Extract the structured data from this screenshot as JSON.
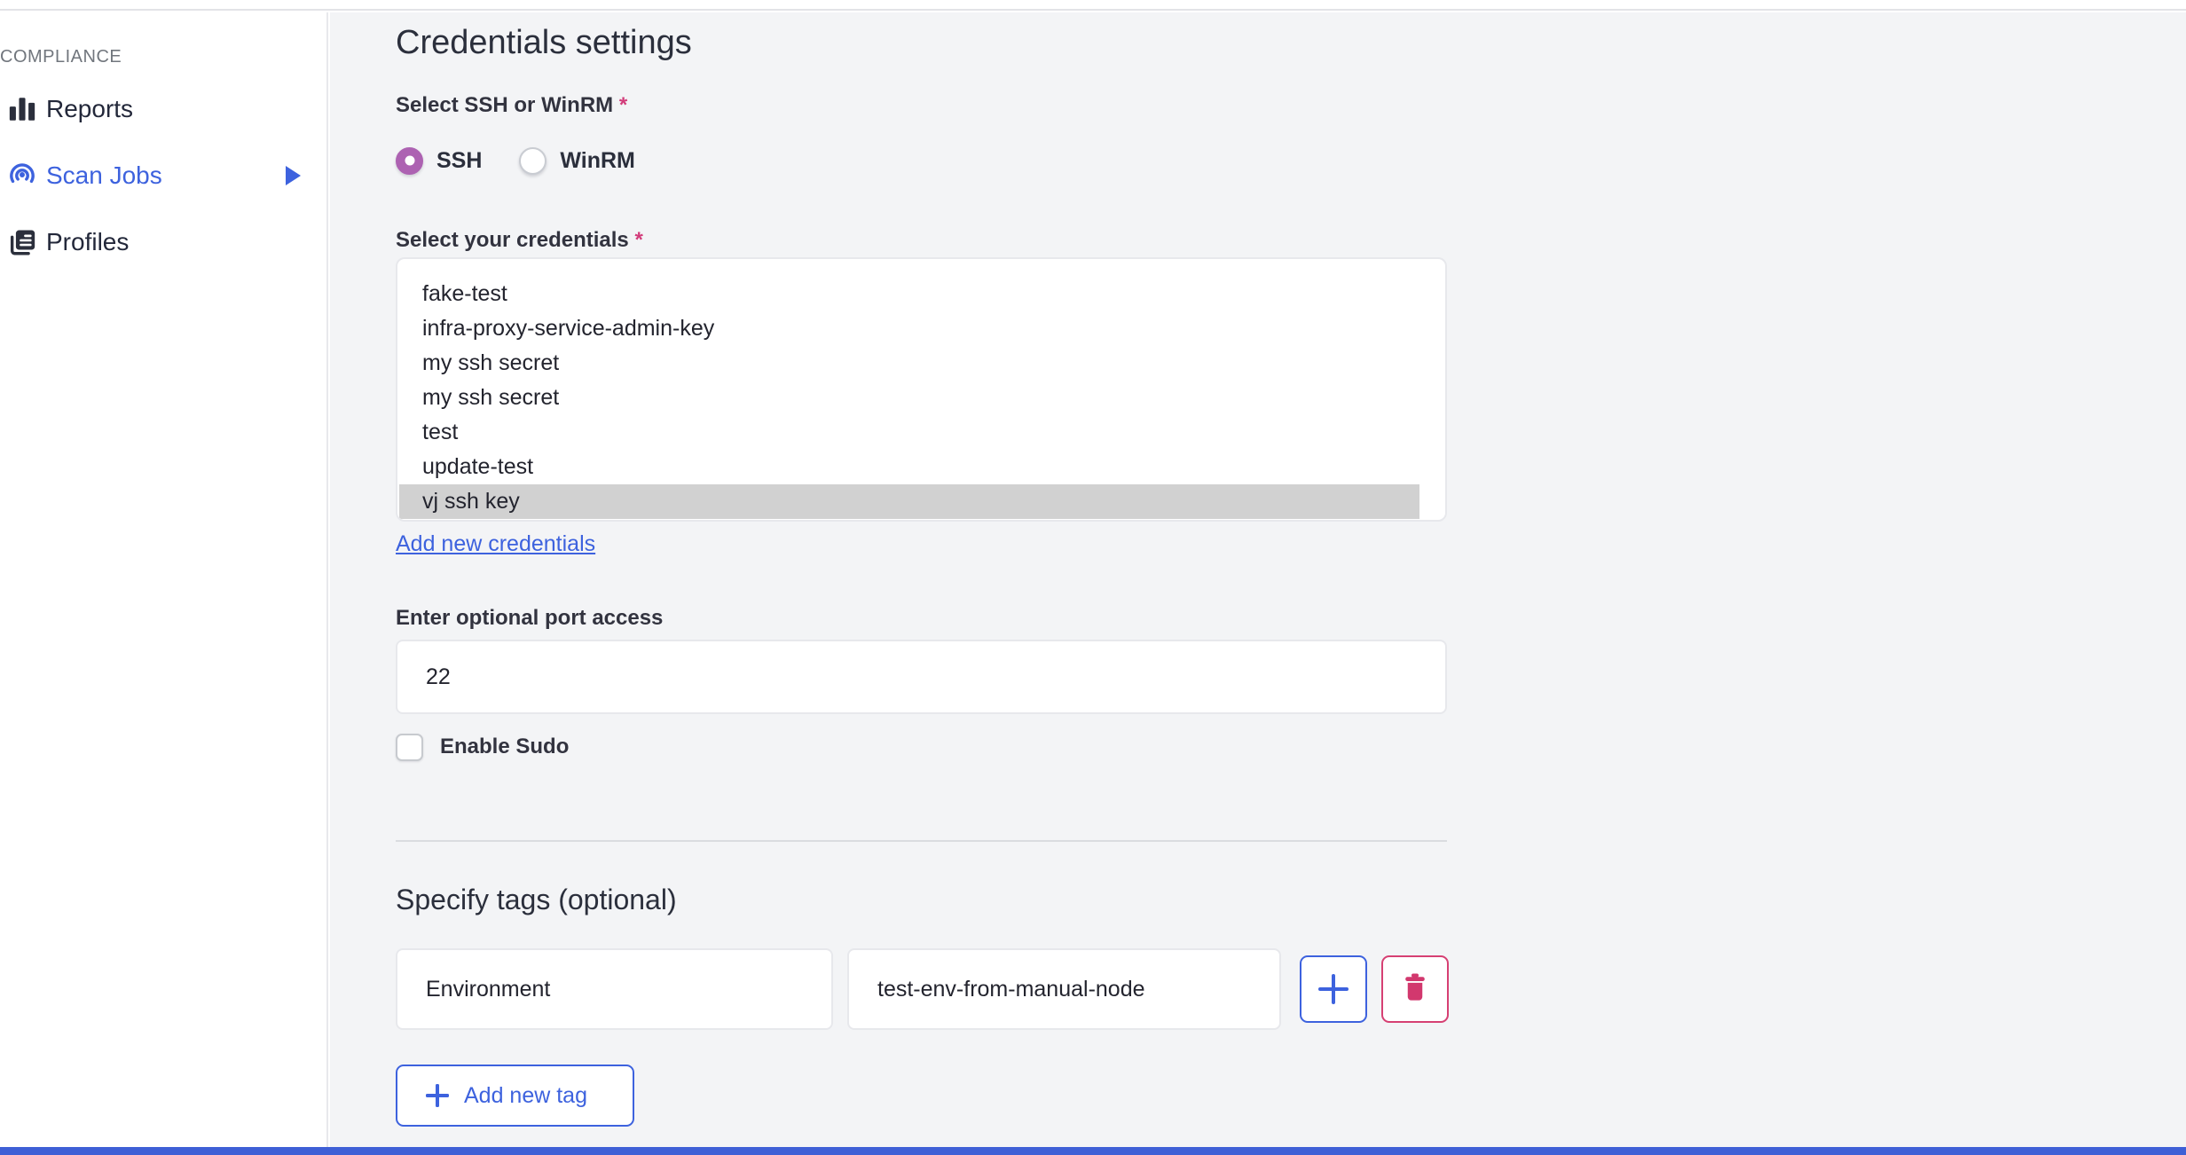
{
  "header": {
    "title": "Credentials settings"
  },
  "sidebar": {
    "section_label": "COMPLIANCE",
    "items": [
      {
        "label": "Reports",
        "icon": "bar-chart-icon",
        "active": false
      },
      {
        "label": "Scan Jobs",
        "icon": "radar-icon",
        "active": true,
        "expand_icon": "arrow-right-icon"
      },
      {
        "label": "Profiles",
        "icon": "documents-icon",
        "active": false
      }
    ]
  },
  "form": {
    "protocol": {
      "label": "Select SSH or WinRM",
      "required_mark": "*",
      "options": [
        {
          "label": "SSH",
          "selected": true
        },
        {
          "label": "WinRM",
          "selected": false
        }
      ]
    },
    "credentials": {
      "label": "Select your credentials",
      "required_mark": "*",
      "options": [
        "fake-test",
        "infra-proxy-service-admin-key",
        "my ssh secret",
        "my ssh secret",
        "test",
        "update-test",
        "vj ssh key"
      ],
      "selected_option": "vj ssh key",
      "add_link": "Add new credentials"
    },
    "port": {
      "label": "Enter optional port access",
      "value": "22"
    },
    "sudo": {
      "label": "Enable Sudo",
      "checked": false
    },
    "tags": {
      "heading": "Specify tags (optional)",
      "rows": [
        {
          "key": "Environment",
          "value": "test-env-from-manual-node"
        }
      ],
      "add_row_icon": "plus-icon",
      "delete_row_icon": "trash-icon",
      "add_button_label": "Add new tag"
    }
  },
  "colors": {
    "accent_blue": "#3d62de",
    "bottom_bar_blue": "#3e5fd6",
    "radio_purple": "#ad62b2",
    "danger_pink": "#d2386e",
    "selected_row_gray": "#d1d1d1",
    "required_asterisk": "#d23c7a",
    "main_background": "#f3f4f6"
  }
}
